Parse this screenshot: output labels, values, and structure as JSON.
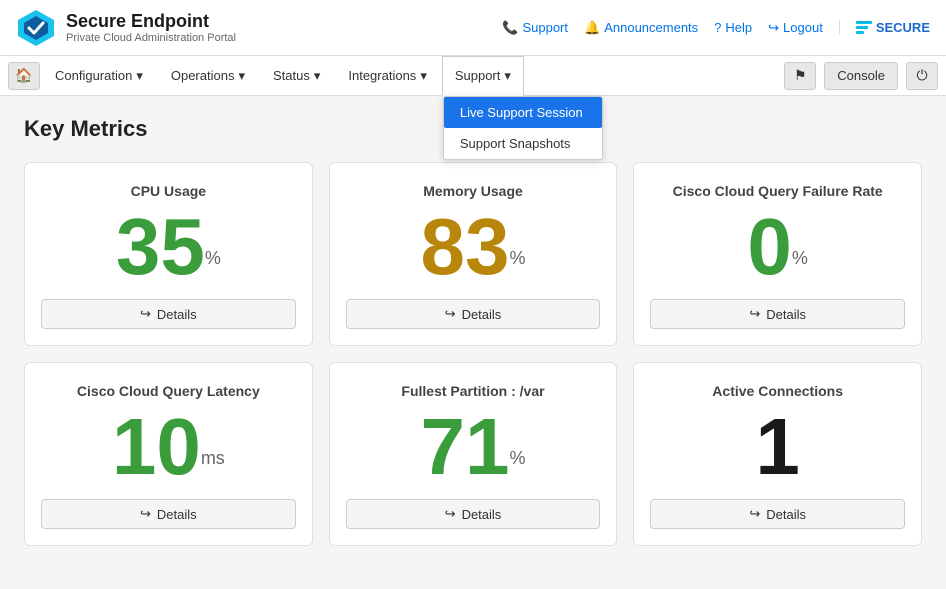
{
  "app": {
    "title": "Secure Endpoint",
    "subtitle": "Private Cloud Administration Portal"
  },
  "top_nav": {
    "support_link": "Support",
    "announcements_link": "Announcements",
    "help_link": "Help",
    "logout_link": "Logout",
    "cisco_label": "SECURE"
  },
  "nav_bar": {
    "items": [
      {
        "label": "Configuration",
        "has_dropdown": true
      },
      {
        "label": "Operations",
        "has_dropdown": true
      },
      {
        "label": "Status",
        "has_dropdown": true
      },
      {
        "label": "Integrations",
        "has_dropdown": true
      },
      {
        "label": "Support",
        "has_dropdown": true,
        "active": true
      }
    ],
    "console_label": "Console"
  },
  "support_dropdown": {
    "items": [
      {
        "label": "Live Support Session",
        "highlighted": true
      },
      {
        "label": "Support Snapshots",
        "highlighted": false
      }
    ]
  },
  "page": {
    "title": "Key Metrics"
  },
  "metrics": [
    {
      "label": "CPU Usage",
      "value": "35",
      "unit": "%",
      "color": "green",
      "details_label": "Details"
    },
    {
      "label": "Memory Usage",
      "value": "83",
      "unit": "%",
      "color": "dark-yellow",
      "details_label": "Details"
    },
    {
      "label": "Cisco Cloud Query Failure Rate",
      "value": "0",
      "unit": "%",
      "color": "green",
      "details_label": "Details"
    },
    {
      "label": "Cisco Cloud Query Latency",
      "value": "10",
      "unit": "ms",
      "color": "green",
      "details_label": "Details"
    },
    {
      "label": "Fullest Partition : /var",
      "value": "71",
      "unit": "%",
      "color": "green",
      "details_label": "Details"
    },
    {
      "label": "Active Connections",
      "value": "1",
      "unit": "",
      "color": "black",
      "details_label": "Details"
    }
  ]
}
